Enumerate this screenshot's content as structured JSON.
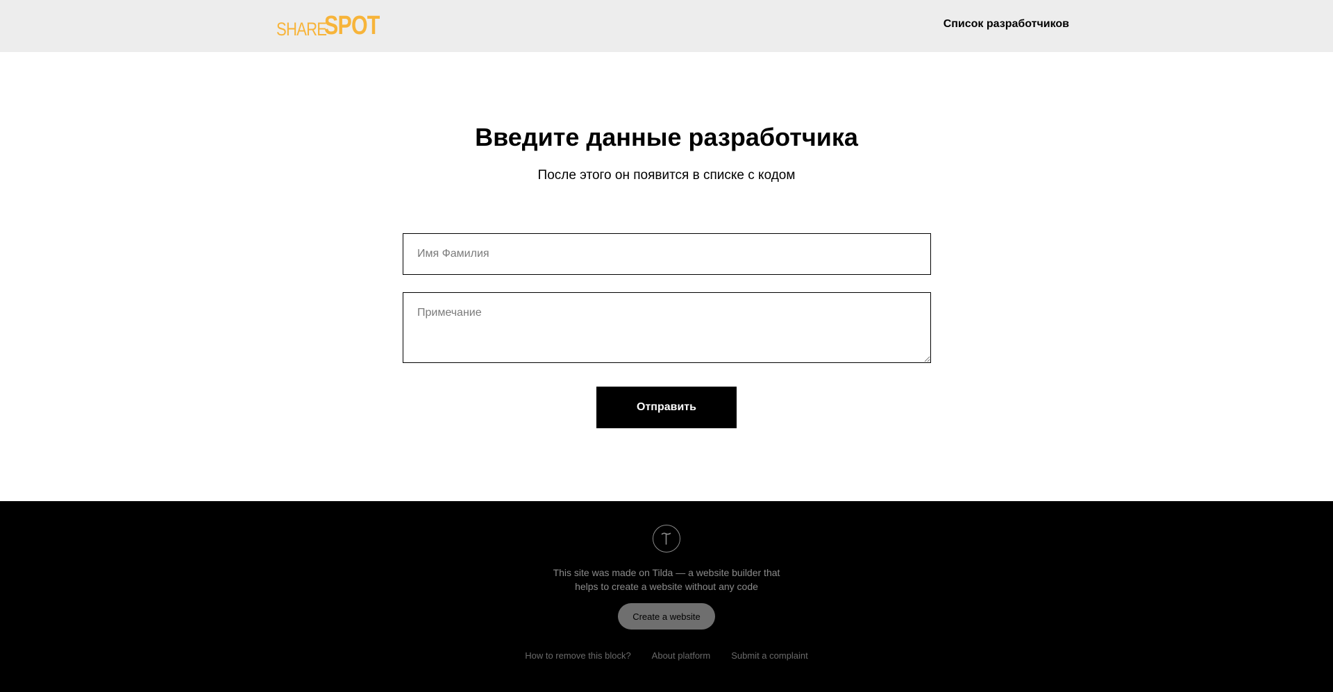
{
  "header": {
    "logo_part1": "SHARE",
    "logo_part2": "SPOT",
    "nav_link": "Список разработчиков"
  },
  "form": {
    "title": "Введите данные разработчика",
    "subtitle": "После этого он появится в списке с кодом",
    "name_placeholder": "Имя Фамилия",
    "name_value": "",
    "note_placeholder": "Примечание",
    "note_value": "",
    "submit_label": "Отправить"
  },
  "footer": {
    "text_line1": "This site was made on Tilda — a website builder that",
    "text_line2": "helps to create a website without any code",
    "create_button": "Create a website",
    "links": [
      "How to remove this block?",
      "About platform",
      "Submit a complaint"
    ]
  },
  "colors": {
    "brand": "#f7b43a",
    "header_bg": "#ededed",
    "footer_bg": "#000000",
    "button_bg": "#000000"
  },
  "icons": {
    "footer_logo": "tilda-icon"
  }
}
